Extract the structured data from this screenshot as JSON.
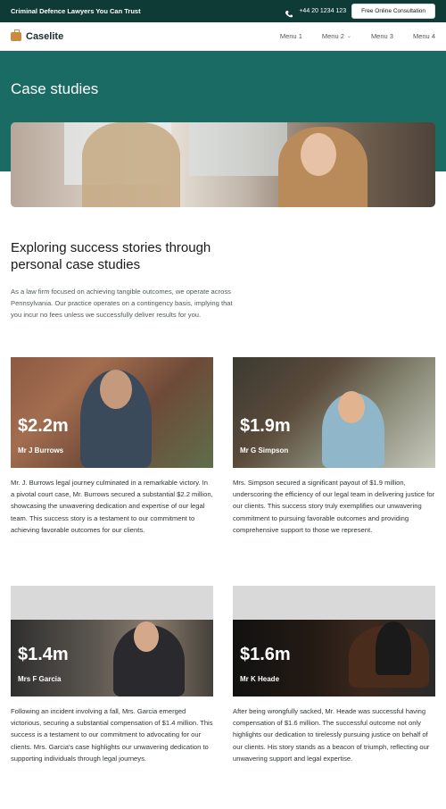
{
  "topbar": {
    "tagline": "Criminal Defence Lawyers You Can Trust",
    "phone": "+44 20 1234 123",
    "consult_label": "Free Online Consultation",
    "icon": "phone-icon"
  },
  "navbar": {
    "brand": "Caselite",
    "brand_icon": "briefcase-icon",
    "menu": [
      {
        "label": "Menu 1"
      },
      {
        "label": "Menu 2"
      },
      {
        "label": "Menu 3"
      },
      {
        "label": "Menu 4"
      }
    ]
  },
  "hero": {
    "title": "Case studies",
    "bg_color": "#196b63"
  },
  "intro": {
    "heading": "Exploring success stories through personal case studies",
    "body": "As a law firm focused on achieving tangible outcomes, we operate across Pennsylvania. Our practice operates on a contingency basis, implying that you incur no fees unless we successfully deliver results for you."
  },
  "cases": [
    {
      "amount": "$2.2m",
      "name": "Mr J Burrows",
      "text": "Mr. J. Burrows legal journey culminated in a remarkable victory. In a pivotal court case, Mr. Burrows secured a substantial $2.2 million, showcasing the unwavering dedication and expertise of our legal team. This success story is a testament to our commitment to achieving favorable outcomes for our clients."
    },
    {
      "amount": "$1.9m",
      "name": "Mr G Simpson",
      "text": "Mrs. Simpson secured a significant payout of $1.9 million, underscoring the efficiency of our legal team in delivering justice for our clients. This success story truly exemplifies our unwavering commitment to pursuing favorable outcomes and providing comprehensive support to those we represent."
    },
    {
      "amount": "$1.4m",
      "name": "Mrs F Garcia",
      "text": "Following an incident involving a fall, Mrs. Garcia emerged victorious, securing a substantial compensation of $1.4 million. This success is a testament to our commitment to advocating for our clients. Mrs. Garcia's case highlights our unwavering dedication to supporting individuals through legal journeys."
    },
    {
      "amount": "$1.6m",
      "name": "Mr K Heade",
      "text": "After being wrongfully sacked, Mr. Heade was successful having compensation of $1.6 million. The successful outcome not only highlights our dedication to tirelessly pursuing justice on behalf of our clients. His story stands as a beacon of triumph, reflecting our unwavering support and legal expertise."
    }
  ]
}
